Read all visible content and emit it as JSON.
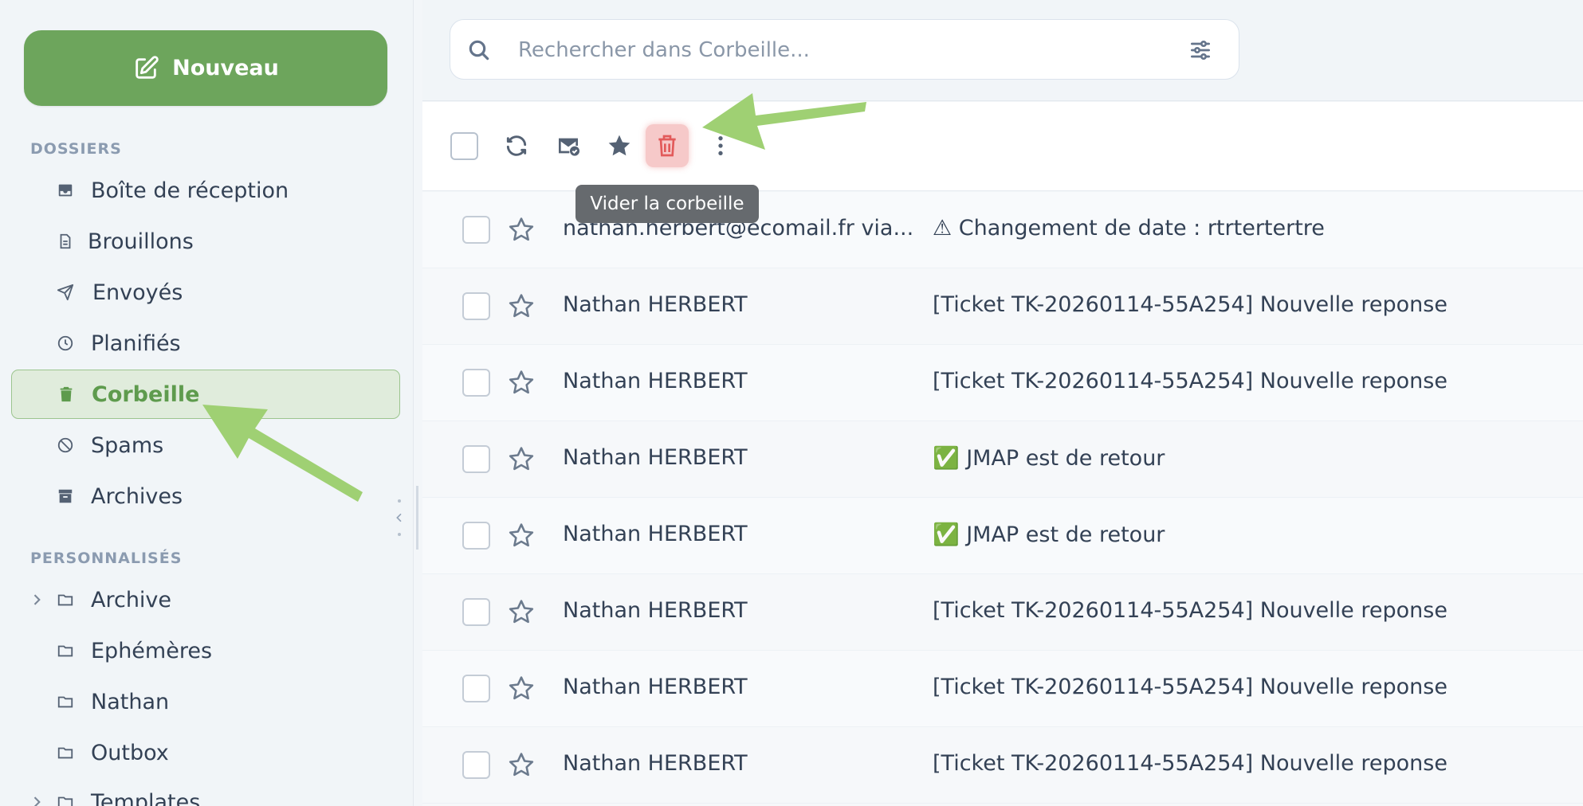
{
  "compose": {
    "label": "Nouveau"
  },
  "sidebar": {
    "folders_title": "DOSSIERS",
    "folders": [
      {
        "label": "Boîte de réception",
        "icon": "inbox-icon"
      },
      {
        "label": "Brouillons",
        "icon": "draft-icon"
      },
      {
        "label": "Envoyés",
        "icon": "send-icon"
      },
      {
        "label": "Planifiés",
        "icon": "clock-icon"
      },
      {
        "label": "Corbeille",
        "icon": "trash-icon",
        "active": true
      },
      {
        "label": "Spams",
        "icon": "ban-icon"
      },
      {
        "label": "Archives",
        "icon": "archive-icon"
      }
    ],
    "custom_title": "PERSONNALISÉS",
    "custom": [
      {
        "label": "Archive",
        "icon": "folder-icon",
        "expandable": true
      },
      {
        "label": "Ephémères",
        "icon": "folder-icon"
      },
      {
        "label": "Nathan",
        "icon": "folder-icon"
      },
      {
        "label": "Outbox",
        "icon": "folder-icon"
      },
      {
        "label": "Templates",
        "icon": "folder-icon",
        "expandable": true
      }
    ]
  },
  "search": {
    "placeholder": "Rechercher dans Corbeille..."
  },
  "toolbar": {
    "tooltip": "Vider la corbeille"
  },
  "messages": [
    {
      "sender": "nathan.herbert@ecomail.fr via...",
      "subject": "⚠ Changement de date : rtrtertertre"
    },
    {
      "sender": "Nathan HERBERT",
      "subject": "[Ticket TK-20260114-55A254] Nouvelle reponse"
    },
    {
      "sender": "Nathan HERBERT",
      "subject": "[Ticket TK-20260114-55A254] Nouvelle reponse"
    },
    {
      "sender": "Nathan HERBERT",
      "subject": "✅ JMAP est de retour"
    },
    {
      "sender": "Nathan HERBERT",
      "subject": "✅ JMAP est de retour"
    },
    {
      "sender": "Nathan HERBERT",
      "subject": "[Ticket TK-20260114-55A254] Nouvelle reponse"
    },
    {
      "sender": "Nathan HERBERT",
      "subject": "[Ticket TK-20260114-55A254] Nouvelle reponse"
    },
    {
      "sender": "Nathan HERBERT",
      "subject": "[Ticket TK-20260114-55A254] Nouvelle reponse"
    }
  ],
  "colors": {
    "accent": "#6da55c",
    "danger": "#e25a5a",
    "annotation": "#9fd073"
  }
}
